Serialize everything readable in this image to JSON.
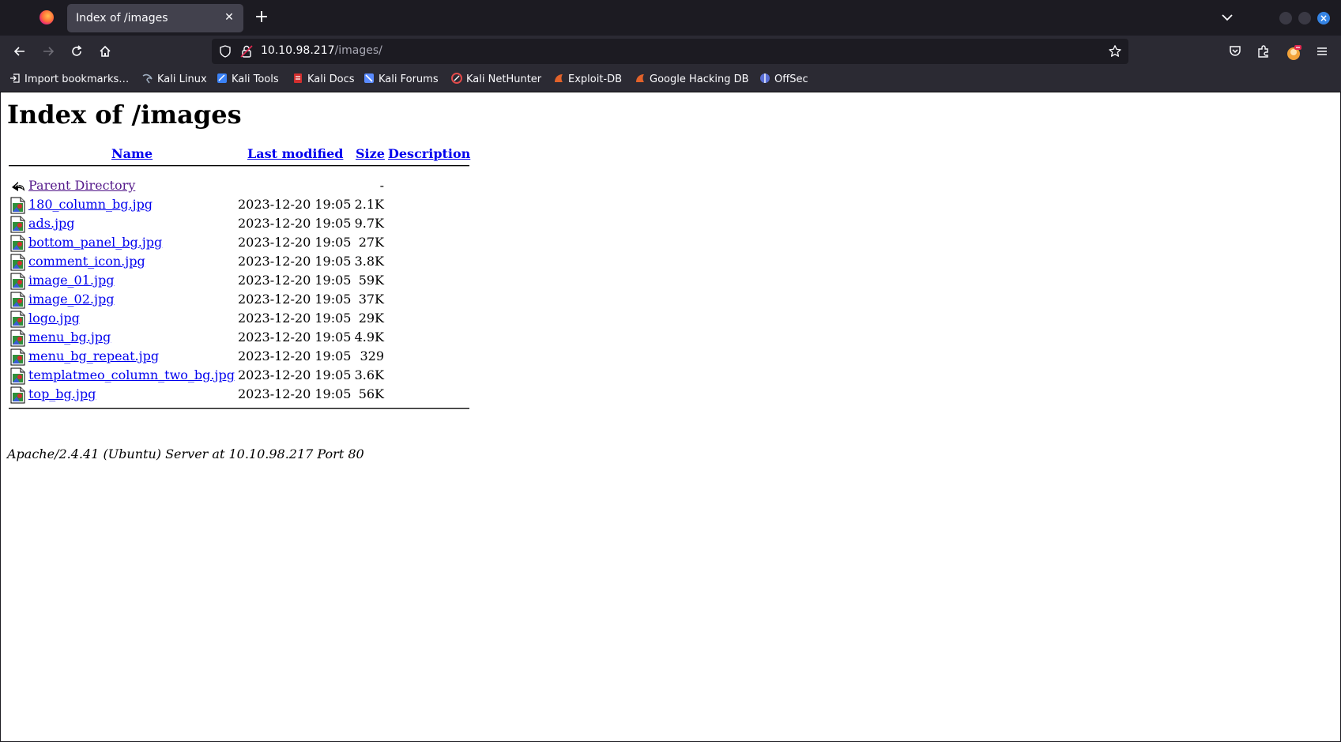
{
  "browser": {
    "tab": {
      "title": "Index of /images",
      "close_symbol": "✕"
    },
    "new_tab_symbol": "+",
    "url": {
      "host": "10.10.98.217",
      "path": "/images/"
    },
    "bookmarks": [
      {
        "label": "Import bookmarks…",
        "icon": "import-icon",
        "color": "#fbfbfe"
      },
      {
        "label": "Kali Linux",
        "icon": "kali-dragon-icon",
        "color": "#6b7a8f"
      },
      {
        "label": "Kali Tools",
        "icon": "kali-tools-icon",
        "color": "#3b82f6"
      },
      {
        "label": "Kali Docs",
        "icon": "kali-docs-icon",
        "color": "#d22f2f"
      },
      {
        "label": "Kali Forums",
        "icon": "kali-forums-icon",
        "color": "#5a8bff"
      },
      {
        "label": "Kali NetHunter",
        "icon": "nethunter-icon",
        "color": "#e24a4a"
      },
      {
        "label": "Exploit-DB",
        "icon": "exploit-db-icon",
        "color": "#e2622a"
      },
      {
        "label": "Google Hacking DB",
        "icon": "ghdb-icon",
        "color": "#e2622a"
      },
      {
        "label": "OffSec",
        "icon": "offsec-icon",
        "color": "#5a6fd6"
      }
    ]
  },
  "page": {
    "title": "Index of /images",
    "columns": {
      "name": "Name",
      "last_modified": "Last modified",
      "size": "Size",
      "description": "Description"
    },
    "parent": {
      "name": "Parent Directory",
      "size": "-"
    },
    "files": [
      {
        "name": "180_column_bg.jpg",
        "modified": "2023-12-20 19:05",
        "size": "2.1K"
      },
      {
        "name": "ads.jpg",
        "modified": "2023-12-20 19:05",
        "size": "9.7K"
      },
      {
        "name": "bottom_panel_bg.jpg",
        "modified": "2023-12-20 19:05",
        "size": "27K"
      },
      {
        "name": "comment_icon.jpg",
        "modified": "2023-12-20 19:05",
        "size": "3.8K"
      },
      {
        "name": "image_01.jpg",
        "modified": "2023-12-20 19:05",
        "size": "59K"
      },
      {
        "name": "image_02.jpg",
        "modified": "2023-12-20 19:05",
        "size": "37K"
      },
      {
        "name": "logo.jpg",
        "modified": "2023-12-20 19:05",
        "size": "29K"
      },
      {
        "name": "menu_bg.jpg",
        "modified": "2023-12-20 19:05",
        "size": "4.9K"
      },
      {
        "name": "menu_bg_repeat.jpg",
        "modified": "2023-12-20 19:05",
        "size": "329"
      },
      {
        "name": "templatmeo_column_two_bg.jpg",
        "modified": "2023-12-20 19:05",
        "size": "3.6K"
      },
      {
        "name": "top_bg.jpg",
        "modified": "2023-12-20 19:05",
        "size": "56K"
      }
    ],
    "footer": "Apache/2.4.41 (Ubuntu) Server at 10.10.98.217 Port 80"
  }
}
